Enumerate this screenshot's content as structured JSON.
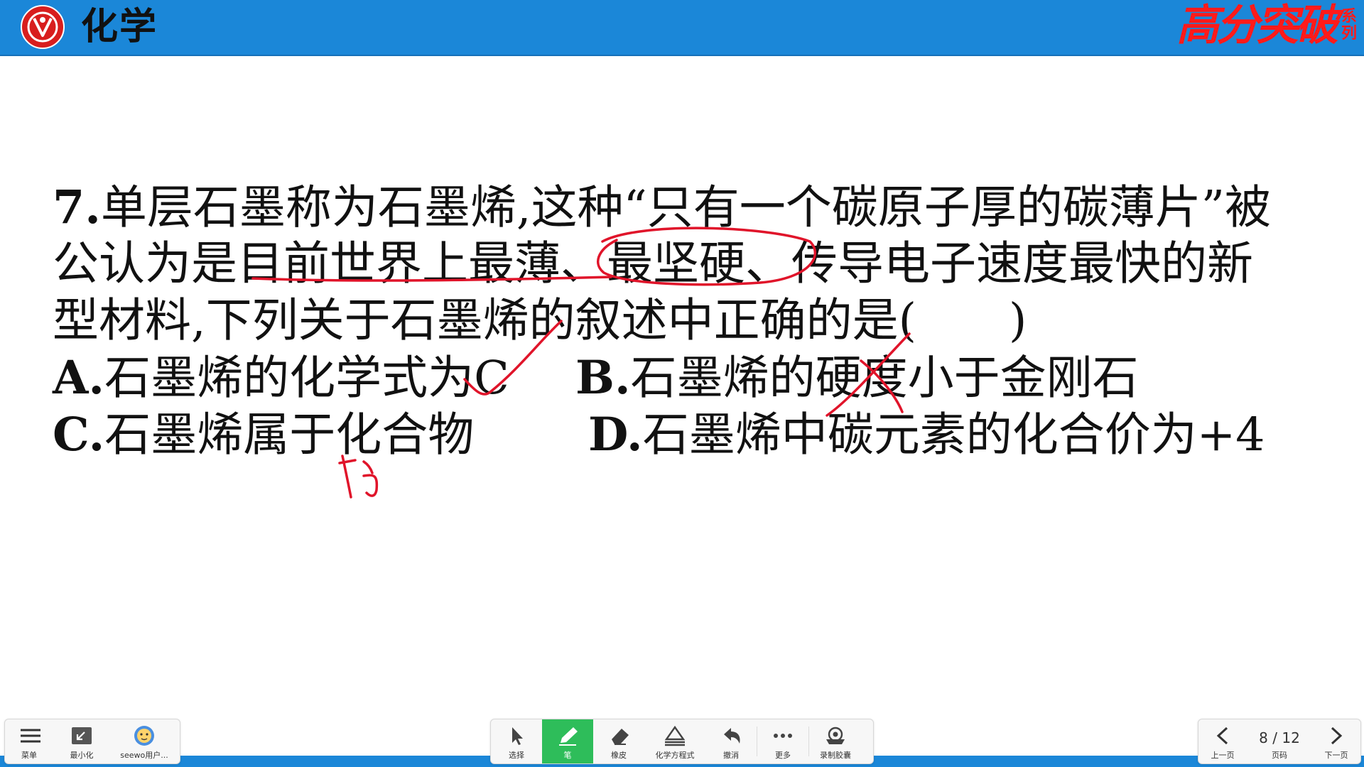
{
  "header": {
    "title": "化学",
    "brand": "高分突破",
    "brand_sub": "系列",
    "accent_color": "#1b87d8",
    "logo_icon": "red-emblem-icon"
  },
  "question": {
    "lines": [
      "单层石墨称为石墨烯,这种“只有一个碳原子厚的碳薄片”被",
      "公认为是目前世界上最薄、最坚硬、传导电子速度最快的新",
      "型材料,下列关于石墨烯的叙述中正确的是(　　)"
    ],
    "number": "7.",
    "options": {
      "a_letter": "A.",
      "a_text": "石墨烯的化学式为C",
      "b_letter": "B.",
      "b_text": "石墨烯的硬度小于金刚石",
      "c_letter": "C.",
      "c_text": "石墨烯属于化合物",
      "d_letter": "D.",
      "d_text": "石墨烯中碳元素的化合价为+4"
    },
    "handwritten_note": "单质",
    "ink_color": "#e0142a"
  },
  "toolbar": {
    "left": [
      {
        "label": "菜单",
        "icon": "menu-icon"
      },
      {
        "label": "最小化",
        "icon": "minimize-icon"
      },
      {
        "label": "seewo用户...",
        "icon": "user-avatar-icon"
      }
    ],
    "center": [
      {
        "label": "选择",
        "icon": "cursor-icon"
      },
      {
        "label": "笔",
        "icon": "pen-icon"
      },
      {
        "label": "橡皮",
        "icon": "eraser-icon"
      },
      {
        "label": "化学方程式",
        "icon": "chemical-equation-icon"
      },
      {
        "label": "撤消",
        "icon": "undo-icon"
      },
      {
        "label": "更多",
        "icon": "more-icon"
      },
      {
        "label": "录制胶囊",
        "icon": "record-icon"
      }
    ],
    "right": {
      "prev_label": "上一页",
      "page_label": "页码",
      "page_value": "8 / 12",
      "next_label": "下一页"
    },
    "active_tool": "笔",
    "active_color": "#2ebd5a"
  }
}
